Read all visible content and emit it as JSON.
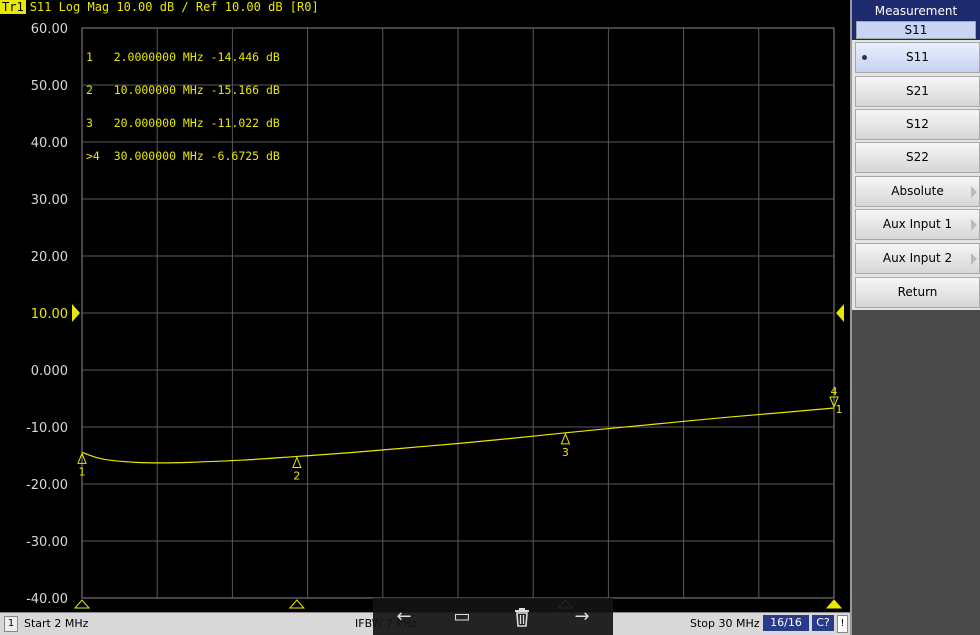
{
  "trace": {
    "badge": "Tr1",
    "title": "S11 Log Mag 10.00 dB / Ref 10.00 dB [R0]"
  },
  "markers": [
    {
      "label": "1",
      "row": "1   2.0000000 MHz -14.446 dB",
      "freq_mhz": 2,
      "value_db": -14.446
    },
    {
      "label": "2",
      "row": "2   10.000000 MHz -15.166 dB",
      "freq_mhz": 10,
      "value_db": -15.166
    },
    {
      "label": "3",
      "row": "3   20.000000 MHz -11.022 dB",
      "freq_mhz": 20,
      "value_db": -11.022
    },
    {
      "label": "4",
      "row": ">4  30.000000 MHz -6.6725 dB",
      "freq_mhz": 30,
      "value_db": -6.6725
    }
  ],
  "chart_data": {
    "type": "line",
    "title": "S11 Log Mag 10.00 dB / Ref 10.00 dB [R0]",
    "xlabel": "",
    "ylabel": "",
    "xlim": [
      2,
      30
    ],
    "ylim": [
      -40,
      60
    ],
    "y_ticks": [
      "60.00",
      "50.00",
      "40.00",
      "30.00",
      "20.00",
      "10.00",
      "0.000",
      "-10.00",
      "-20.00",
      "-30.00",
      "-40.00"
    ],
    "ref_level": "10.00",
    "grid": true,
    "series": [
      {
        "name": "S11",
        "x": [
          2,
          2.5,
          3,
          4,
          5,
          6,
          8,
          10,
          12,
          14,
          16,
          18,
          20,
          22,
          24,
          26,
          28,
          30
        ],
        "values": [
          -14.446,
          -15.3,
          -15.8,
          -16.2,
          -16.3,
          -16.2,
          -15.8,
          -15.166,
          -14.5,
          -13.7,
          -12.9,
          -12.0,
          -11.022,
          -10.1,
          -9.2,
          -8.3,
          -7.5,
          -6.6725
        ]
      }
    ],
    "colors": {
      "trace": "#e8e800",
      "grid": "#5a5a5a",
      "background": "#000000"
    }
  },
  "status_bar": {
    "channel": "1",
    "start": "Start 2 MHz",
    "ifbw": "IFBW 7 kHz",
    "stop": "Stop 30 MHz",
    "sweep": "16/16",
    "cal": "C?",
    "alert": "!"
  },
  "overlay": {
    "icons": [
      "left-arrow-icon",
      "keyboard-icon",
      "trash-icon",
      "right-arrow-icon"
    ],
    "glyphs": [
      "←",
      "▭",
      "🗑",
      "→"
    ]
  },
  "side_panel": {
    "header_title": "Measurement",
    "header_value": "S11",
    "softkeys": [
      {
        "label": "S11",
        "selected": true,
        "submenu": false
      },
      {
        "label": "S21",
        "selected": false,
        "submenu": false
      },
      {
        "label": "S12",
        "selected": false,
        "submenu": false
      },
      {
        "label": "S22",
        "selected": false,
        "submenu": false
      },
      {
        "label": "Absolute",
        "selected": false,
        "submenu": true
      },
      {
        "label": "Aux Input 1",
        "selected": false,
        "submenu": true
      },
      {
        "label": "Aux Input 2",
        "selected": false,
        "submenu": true
      },
      {
        "label": "Return",
        "selected": false,
        "submenu": false
      }
    ]
  }
}
